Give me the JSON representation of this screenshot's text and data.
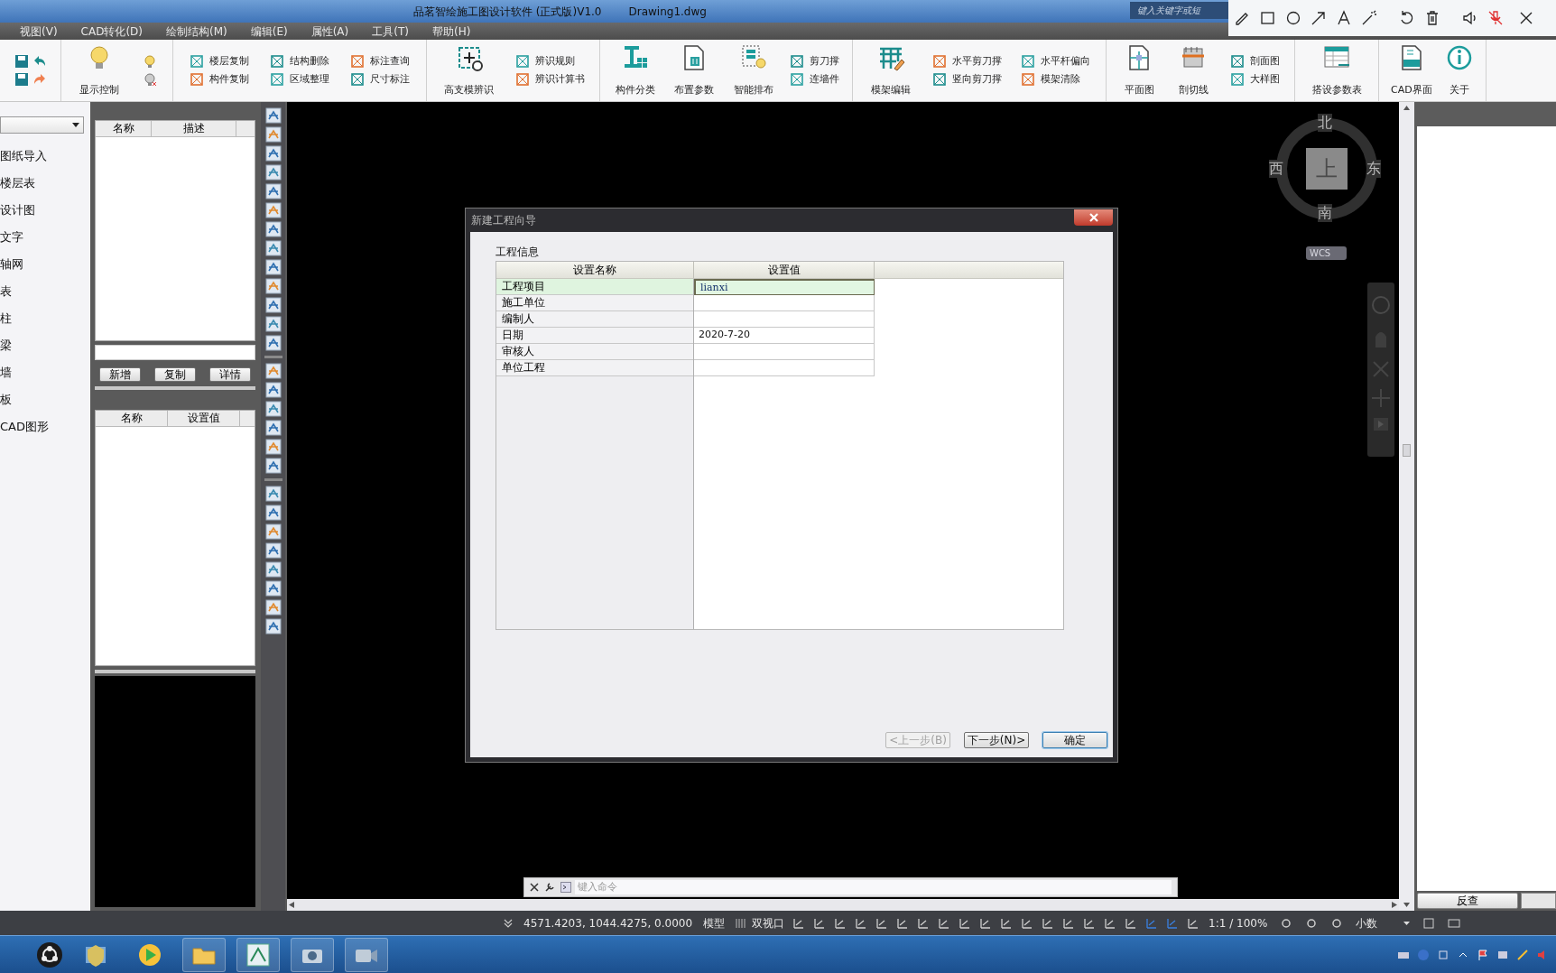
{
  "title_bar": {
    "title": "品茗智绘施工图设计软件 (正式版)V1.0",
    "file": "Drawing1.dwg",
    "search_placeholder": "键入关键字或短"
  },
  "menu": [
    "视图(V)",
    "CAD转化(D)",
    "绘制结构(M)",
    "编辑(E)",
    "属性(A)",
    "工具(T)",
    "帮助(H)"
  ],
  "ribbon": {
    "groups": [
      {
        "items": [
          {
            "kind": "icons"
          }
        ]
      },
      {
        "items": [
          {
            "kind": "large",
            "label": "显示控制"
          },
          {
            "kind": "icons"
          }
        ]
      },
      {
        "items": [
          {
            "kind": "pair",
            "labels": [
              "楼层复制",
              "构件复制"
            ]
          },
          {
            "kind": "pair",
            "labels": [
              "结构删除",
              "区域整理"
            ]
          },
          {
            "kind": "pair",
            "labels": [
              "标注查询",
              "尺寸标注"
            ]
          }
        ]
      },
      {
        "items": [
          {
            "kind": "large",
            "label": "高支模辨识"
          },
          {
            "kind": "pair",
            "labels": [
              "辨识规则",
              "辨识计算书"
            ]
          }
        ]
      },
      {
        "items": [
          {
            "kind": "large",
            "label": "构件分类"
          },
          {
            "kind": "large",
            "label": "布置参数"
          },
          {
            "kind": "large",
            "label": "智能排布"
          },
          {
            "kind": "pair",
            "labels": [
              "剪刀撑",
              "连墙件"
            ]
          }
        ]
      },
      {
        "items": [
          {
            "kind": "large",
            "label": "模架编辑"
          },
          {
            "kind": "pair",
            "labels": [
              "水平剪刀撑",
              "竖向剪刀撑"
            ]
          },
          {
            "kind": "pair",
            "labels": [
              "水平杆偏向",
              "模架清除"
            ]
          }
        ]
      },
      {
        "items": [
          {
            "kind": "large",
            "label": "平面图"
          },
          {
            "kind": "large",
            "label": "剖切线"
          },
          {
            "kind": "pair",
            "labels": [
              "剖面图",
              "大样图"
            ]
          }
        ]
      },
      {
        "items": [
          {
            "kind": "large",
            "label": "搭设参数表"
          }
        ]
      },
      {
        "items": [
          {
            "kind": "large",
            "label": "CAD界面"
          },
          {
            "kind": "large",
            "label": "关于"
          }
        ]
      }
    ]
  },
  "left_panel": {
    "items": [
      "图纸导入",
      "楼层表",
      "设计图",
      "文字",
      "轴网",
      "表",
      "柱",
      "梁",
      "墙",
      "板",
      "CAD图形"
    ]
  },
  "component_panel": {
    "columns": [
      "名称",
      "描述"
    ],
    "buttons": [
      "新增",
      "复制",
      "详情"
    ],
    "property_columns": [
      "名称",
      "设置值"
    ]
  },
  "compass": {
    "north": "北",
    "south": "南",
    "east": "东",
    "west": "西",
    "center": "上",
    "badge": "WCS"
  },
  "command_line": {
    "placeholder": "键入命令"
  },
  "dialog": {
    "title": "新建工程向导",
    "section": "工程信息",
    "columns": [
      "设置名称",
      "设置值"
    ],
    "rows": [
      {
        "name": "工程项目",
        "value": "lianxi",
        "selected": true
      },
      {
        "name": "施工单位",
        "value": "",
        "selected": false
      },
      {
        "name": "编制人",
        "value": "",
        "selected": false
      },
      {
        "name": "日期",
        "value": "2020-7-20",
        "selected": false
      },
      {
        "name": "审核人",
        "value": "",
        "selected": false
      },
      {
        "name": "单位工程",
        "value": "",
        "selected": false
      }
    ],
    "buttons": [
      {
        "label": "<上一步(B)",
        "disabled": true
      },
      {
        "label": "下一步(N)>",
        "disabled": false
      },
      {
        "label": "确定",
        "disabled": false
      }
    ]
  },
  "right_panel": {
    "button": "反查"
  },
  "status_bar": {
    "coordinates": "4571.4203, 1044.4275, 0.0000",
    "model": "模型",
    "viewport": "双视口",
    "scale": "1:1 / 100%",
    "units": "小数"
  }
}
